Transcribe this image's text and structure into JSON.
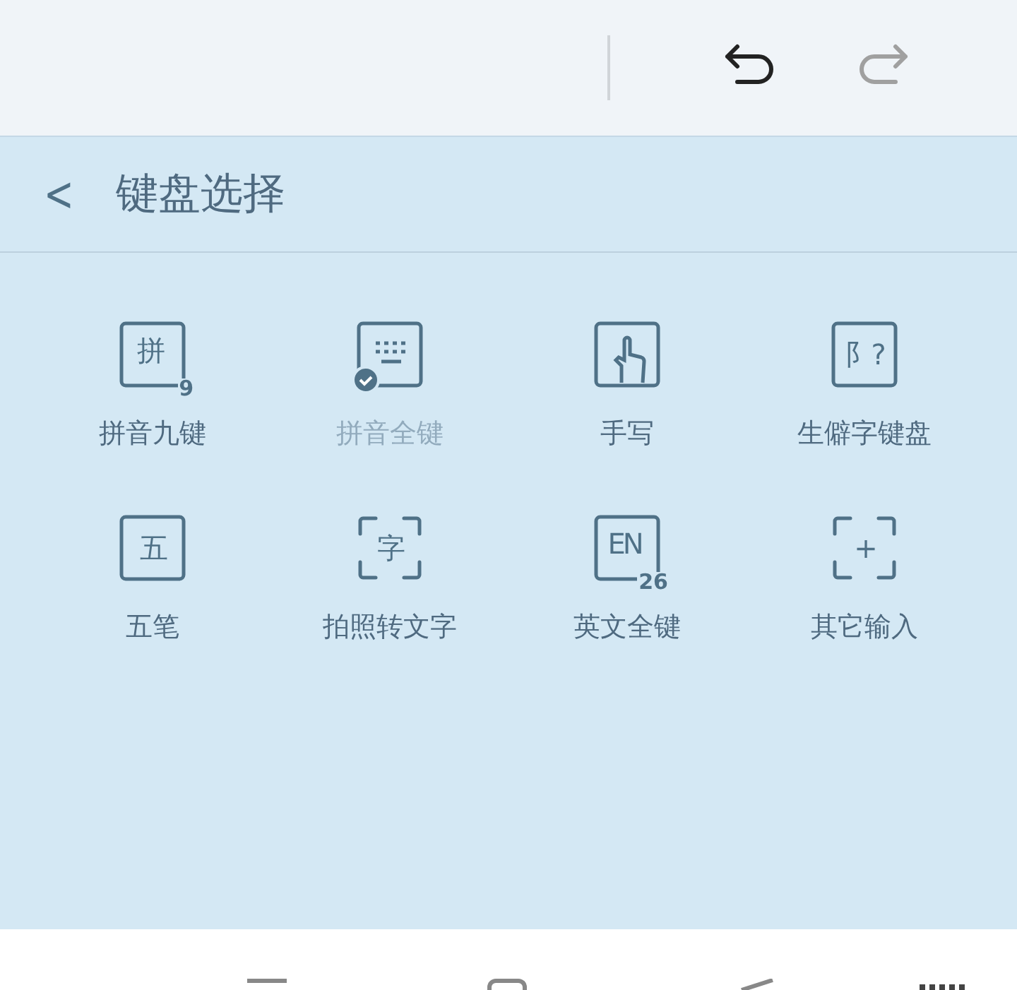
{
  "toolbar": {
    "undo_disabled": false,
    "redo_disabled": true
  },
  "header": {
    "back": "<",
    "title": "键盘选择"
  },
  "keyboards": [
    {
      "kind": "boxed",
      "glyph": "拼",
      "sub": "9",
      "label": "拼音九键",
      "selected": false
    },
    {
      "kind": "keyboard",
      "label": "拼音全键",
      "selected": true
    },
    {
      "kind": "hand",
      "label": "手写",
      "selected": false
    },
    {
      "kind": "boxed",
      "glyph": "阝?",
      "label": "生僻字键盘",
      "selected": false
    },
    {
      "kind": "boxed",
      "glyph": "五",
      "label": "五笔",
      "selected": false
    },
    {
      "kind": "bracketed",
      "glyph": "字",
      "label": "拍照转文字",
      "selected": false
    },
    {
      "kind": "boxed",
      "glyph": "EN",
      "sub": "26",
      "label": "英文全键",
      "selected": false
    },
    {
      "kind": "bracketed",
      "glyph": "+",
      "label": "其它输入",
      "selected": false
    }
  ]
}
